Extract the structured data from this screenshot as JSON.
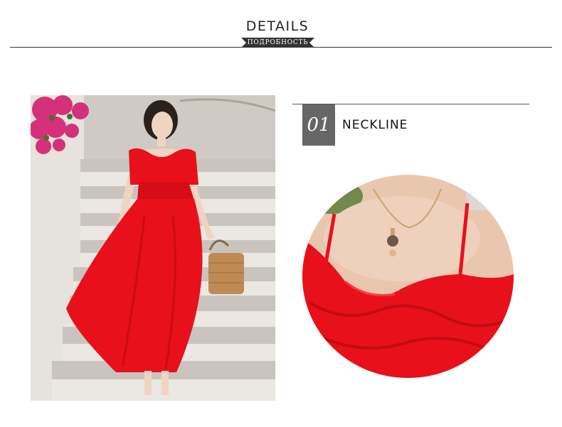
{
  "header": {
    "title": "DETAILS",
    "subtitle": "ПОДРОБНОСТЬ"
  },
  "detail": {
    "number": "01",
    "label": "NECKLINE"
  },
  "colors": {
    "dress_red": "#e8101a",
    "ribbon": "#333333",
    "number_box": "#666666"
  }
}
